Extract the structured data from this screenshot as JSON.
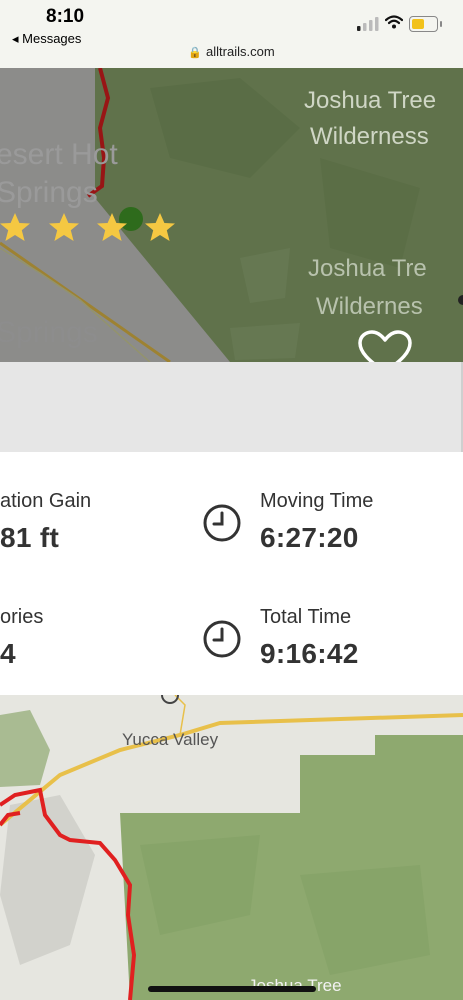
{
  "status_bar": {
    "time": "8:10",
    "back_label": "◂ Messages",
    "url": "alltrails.com",
    "battery_color": "#f2c21b"
  },
  "map_top": {
    "labels": [
      "Joshua Tree",
      "Wilderness",
      "esert Hot",
      "Springs",
      "Joshua Tre",
      "Wildernes",
      "Springs"
    ],
    "rating_stars": 4,
    "favorite_icon": "heart-icon"
  },
  "stats": {
    "elevation_label": "ation Gain",
    "elevation_value": "81 ft",
    "moving_time_label": "Moving Time",
    "moving_time_value": "6:27:20",
    "calories_label": "ories",
    "calories_value": "4",
    "total_time_label": "Total Time",
    "total_time_value": "9:16:42"
  },
  "map_bottom": {
    "labels": [
      "Yucca Valley",
      "Joshua Tree"
    ]
  },
  "colors": {
    "park_green": "#8ea96f",
    "trail_red": "#e02020",
    "road_yellow": "#e8c04a",
    "star_yellow": "#f5c842"
  }
}
